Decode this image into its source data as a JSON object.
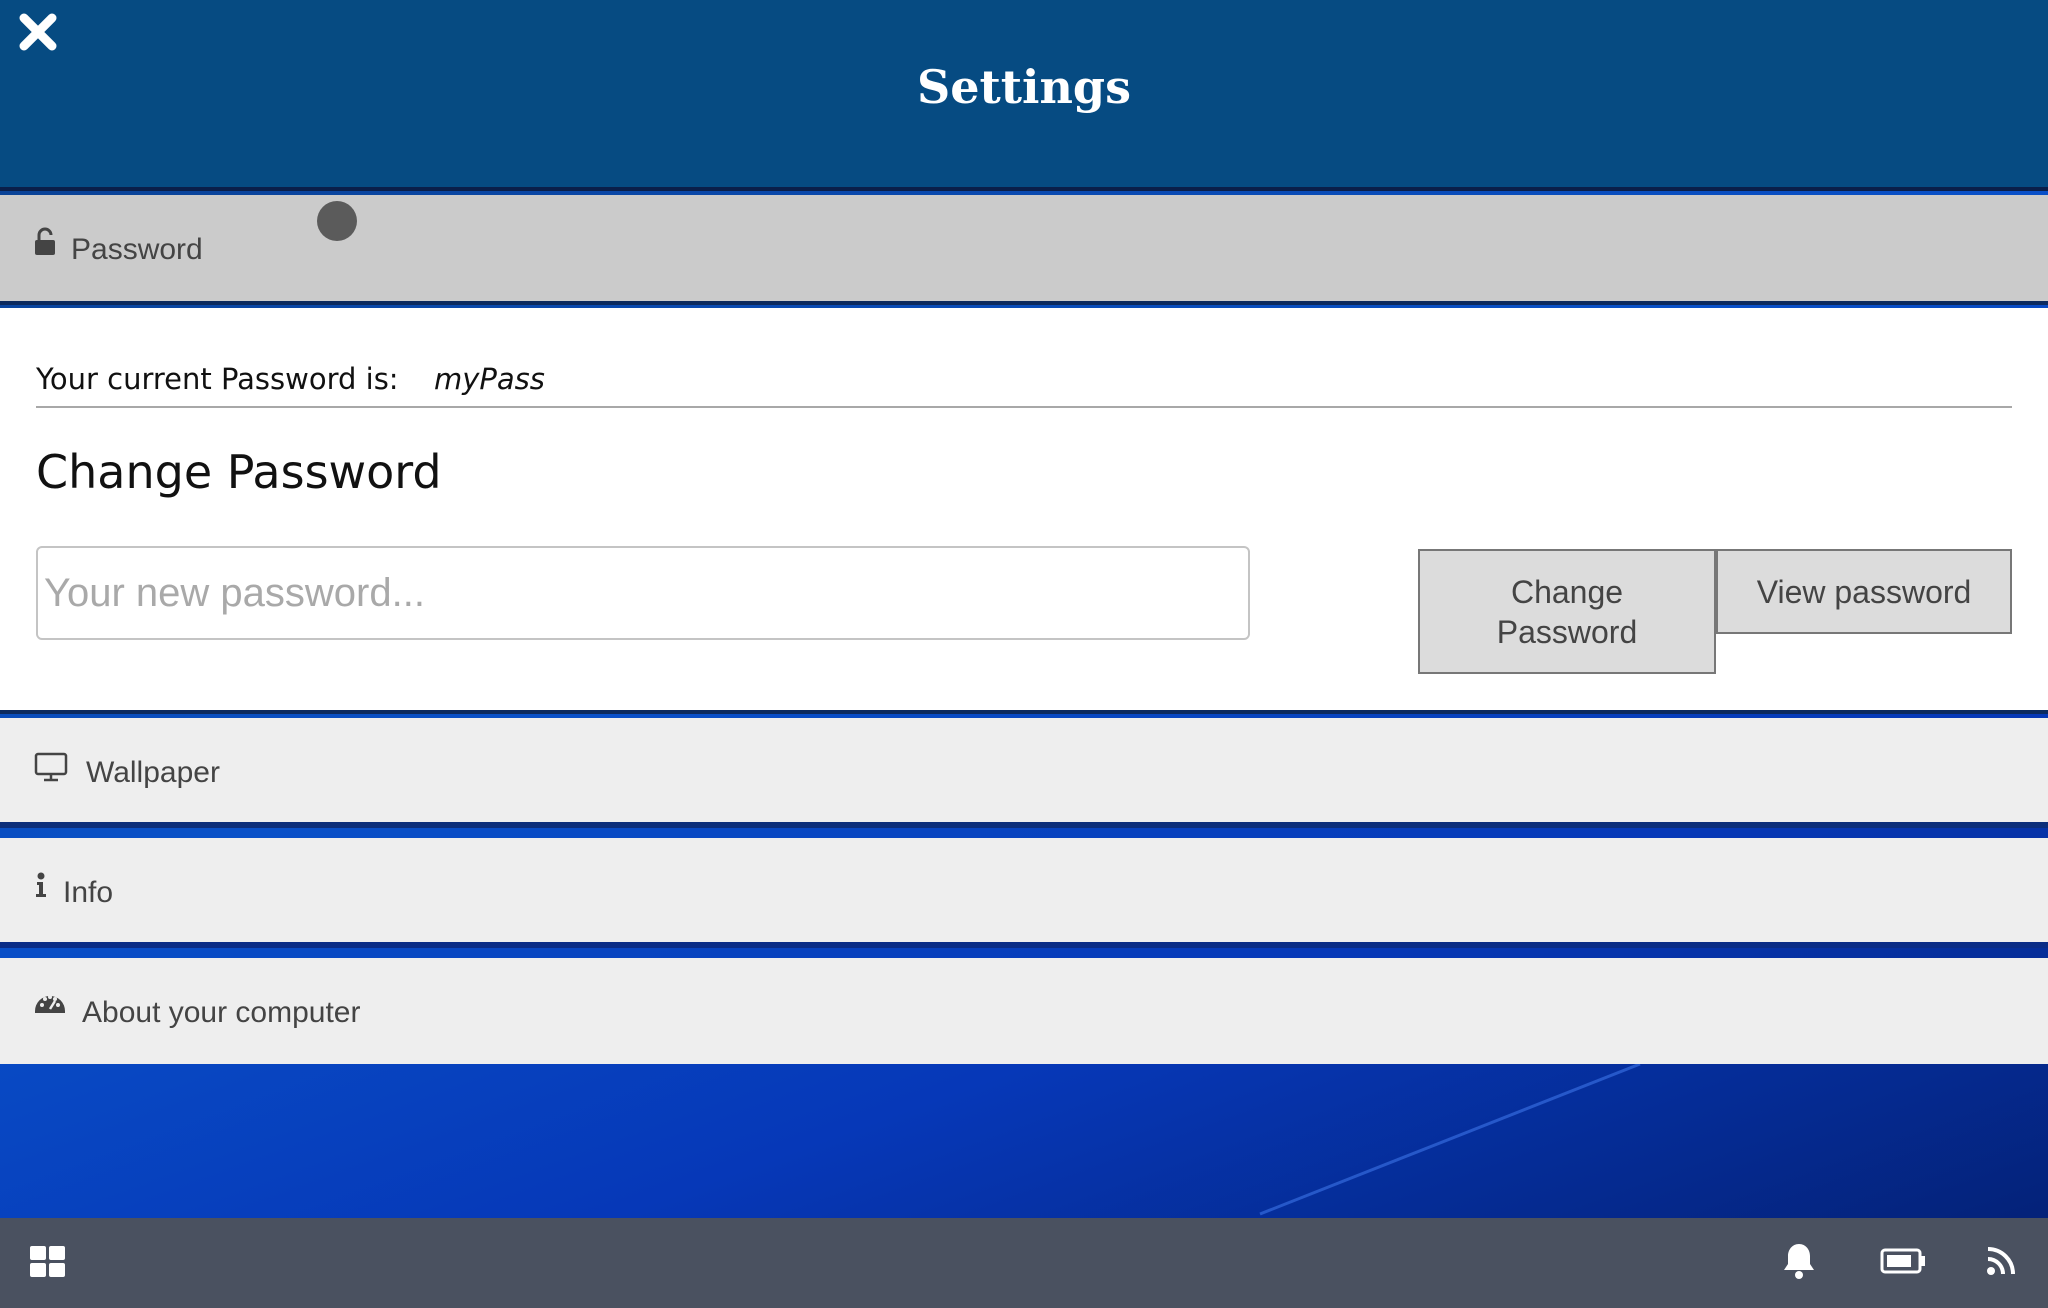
{
  "header": {
    "title": "Settings",
    "close_icon": "close-icon"
  },
  "password_section": {
    "label": "Password",
    "icon": "unlock-icon",
    "current_label": "Your current Password is:",
    "current_value": "myPass",
    "change_title": "Change Password",
    "input_placeholder": "Your new password...",
    "input_value": "",
    "change_button_label": "Change Password",
    "view_button_label": "View password"
  },
  "sections": {
    "wallpaper": {
      "label": "Wallpaper",
      "icon": "monitor-icon"
    },
    "info": {
      "label": "Info",
      "icon": "info-icon"
    },
    "about": {
      "label": "About your computer",
      "icon": "dashboard-icon"
    }
  },
  "taskbar": {
    "start_icon": "grid-icon",
    "tray_icons": [
      "bell-icon",
      "battery-icon",
      "rss-icon"
    ]
  },
  "colors": {
    "header_bg": "#064b82",
    "taskbar_bg": "#4a5160",
    "active_section_bg": "#cbcbcb",
    "section_bg": "#eeeeee"
  }
}
